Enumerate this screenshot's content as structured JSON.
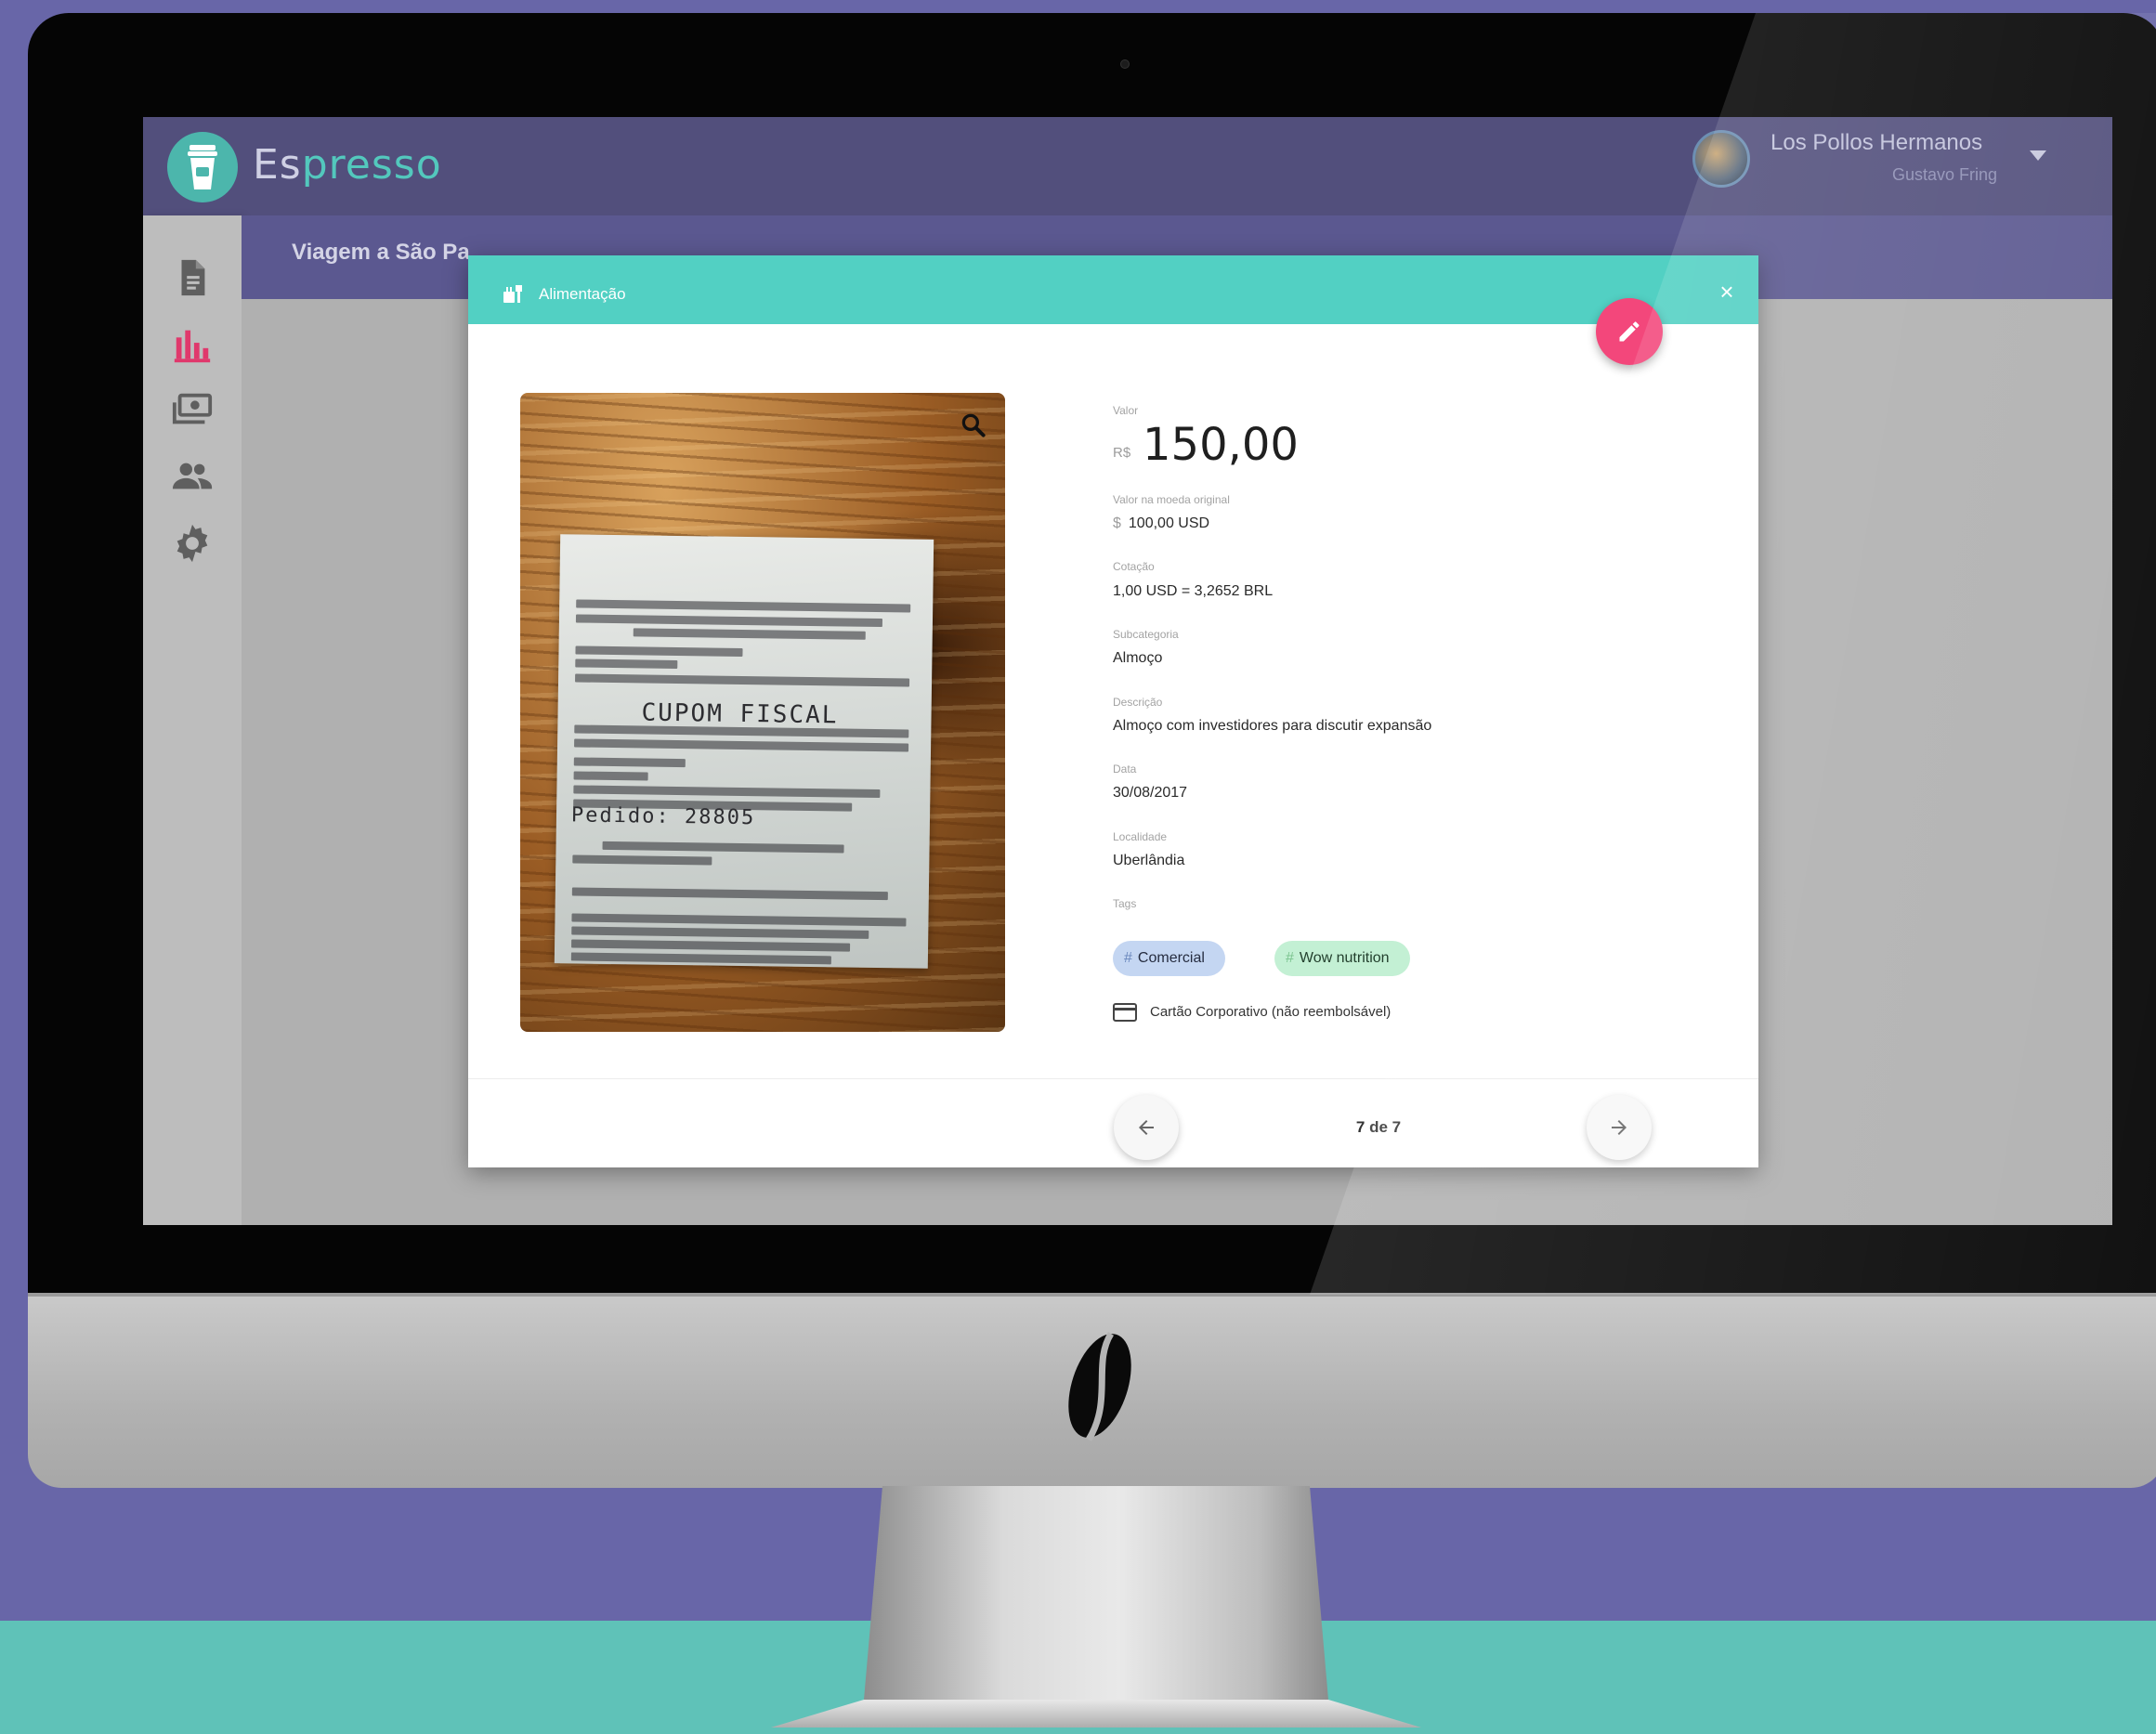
{
  "app": {
    "brand_prefix": "Es",
    "brand_suffix": "presso",
    "company_name": "Los Pollos Hermanos",
    "user_name": "Gustavo Fring"
  },
  "sidebar": {
    "items": [
      {
        "icon": "document-icon",
        "active": false
      },
      {
        "icon": "bar-chart-icon",
        "active": true
      },
      {
        "icon": "money-icon",
        "active": false
      },
      {
        "icon": "people-icon",
        "active": false
      },
      {
        "icon": "gear-icon",
        "active": false
      }
    ]
  },
  "trip": {
    "title": "Viagem a São Pa"
  },
  "modal": {
    "category": "Alimentação",
    "close_symbol": "×",
    "value_label": "Valor",
    "currency_symbol": "R$",
    "amount": "150,00",
    "original_value_label": "Valor na moeda original",
    "original_currency_symbol": "$",
    "original_value": "100,00 USD",
    "rate_label": "Cotação",
    "rate_value": "1,00 USD = 3,2652 BRL",
    "subcategory_label": "Subcategoria",
    "subcategory_value": "Almoço",
    "description_label": "Descrição",
    "description_value": "Almoço com investidores para discutir expansão",
    "date_label": "Data",
    "date_value": "30/08/2017",
    "location_label": "Localidade",
    "location_value": "Uberlândia",
    "tags_label": "Tags",
    "tags": [
      {
        "hash": "#",
        "label": "Comercial"
      },
      {
        "hash": "#",
        "label": "Wow nutrition"
      }
    ],
    "payment_method": "Cartão Corporativo (não reembolsável)",
    "pager": "7 de 7",
    "receipt_heading": "CUPOM FISCAL",
    "receipt_order": "Pedido: 28805"
  },
  "colors": {
    "accent_teal": "#52d0c3",
    "fab_pink": "#f3477b",
    "header_purple": "#524f7c",
    "active_icon": "#e0386c"
  }
}
